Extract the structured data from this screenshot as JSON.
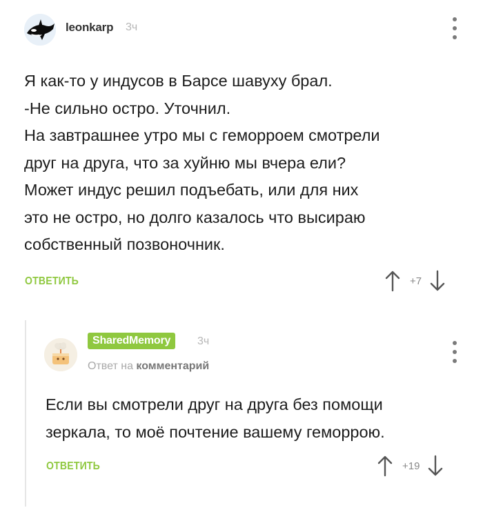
{
  "comments": [
    {
      "username": "leonkarp",
      "time": "3ч",
      "avatar_icon": "orca-avatar-icon",
      "lines": [
        "Я как-то у индусов в Барсе шавуху брал.",
        "-Не сильно остро. Уточнил.",
        "На завтрашнее утро мы с геморроем смотрели",
        "друг на друга, что за хуйню мы вчера ели?",
        "Может индус решил подъебать, или для них",
        "это не остро, но долго казалось что высираю",
        "собственный позвоночник."
      ],
      "reply_label": "ОТВЕТИТЬ",
      "rating": "+7"
    },
    {
      "username": "SharedMemory",
      "time": "3ч",
      "avatar_icon": "cake-avatar-icon",
      "reply_prefix": "Ответ на",
      "reply_target": "комментарий",
      "lines": [
        "Если вы смотрели друг на друга без помощи",
        "зеркала, то моё почтение вашему геморрою."
      ],
      "reply_label": "ОТВЕТИТЬ",
      "rating": "+19"
    }
  ],
  "colors": {
    "accent": "#8fc83f",
    "text": "#1c1c1c",
    "muted": "#b6b6b6"
  }
}
